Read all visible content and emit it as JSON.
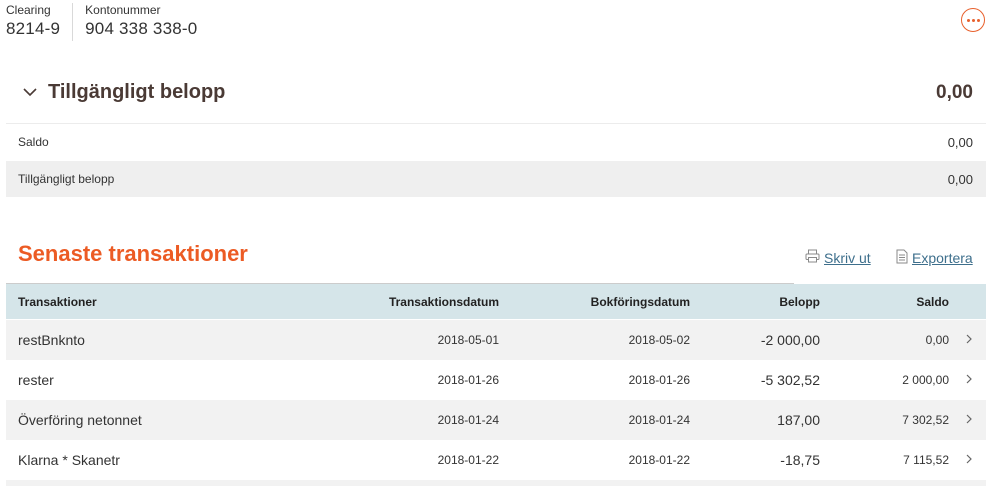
{
  "account": {
    "clearing_label": "Clearing",
    "clearing_value": "8214-9",
    "kontonummer_label": "Kontonummer",
    "kontonummer_value": "904 338 338-0"
  },
  "available": {
    "title": "Tillgängligt belopp",
    "amount": "0,00",
    "rows": [
      {
        "label": "Saldo",
        "value": "0,00"
      },
      {
        "label": "Tillgängligt belopp",
        "value": "0,00"
      }
    ]
  },
  "transactions": {
    "title": "Senaste transaktioner",
    "print_label": "Skriv ut",
    "export_label": "Exportera",
    "columns": {
      "name": "Transaktioner",
      "tdate": "Transaktionsdatum",
      "bdate": "Bokföringsdatum",
      "amount": "Belopp",
      "saldo": "Saldo"
    },
    "rows": [
      {
        "name": "restBnknto",
        "tdate": "2018-05-01",
        "bdate": "2018-05-02",
        "amount": "-2 000,00",
        "saldo": "0,00"
      },
      {
        "name": "rester",
        "tdate": "2018-01-26",
        "bdate": "2018-01-26",
        "amount": "-5 302,52",
        "saldo": "2 000,00"
      },
      {
        "name": "Överföring netonnet",
        "tdate": "2018-01-24",
        "bdate": "2018-01-24",
        "amount": "187,00",
        "saldo": "7 302,52"
      },
      {
        "name": "Klarna * Skanetr",
        "tdate": "2018-01-22",
        "bdate": "2018-01-22",
        "amount": "-18,75",
        "saldo": "7 115,52"
      }
    ]
  },
  "colors": {
    "accent": "#ec5b24",
    "link": "#3e6f8c",
    "table_header": "#d5e5e9"
  },
  "icons": {
    "more": "more-dots-icon",
    "collapse": "chevron-down-icon",
    "print": "printer-icon",
    "export": "document-icon",
    "row": "chevron-right-icon"
  }
}
